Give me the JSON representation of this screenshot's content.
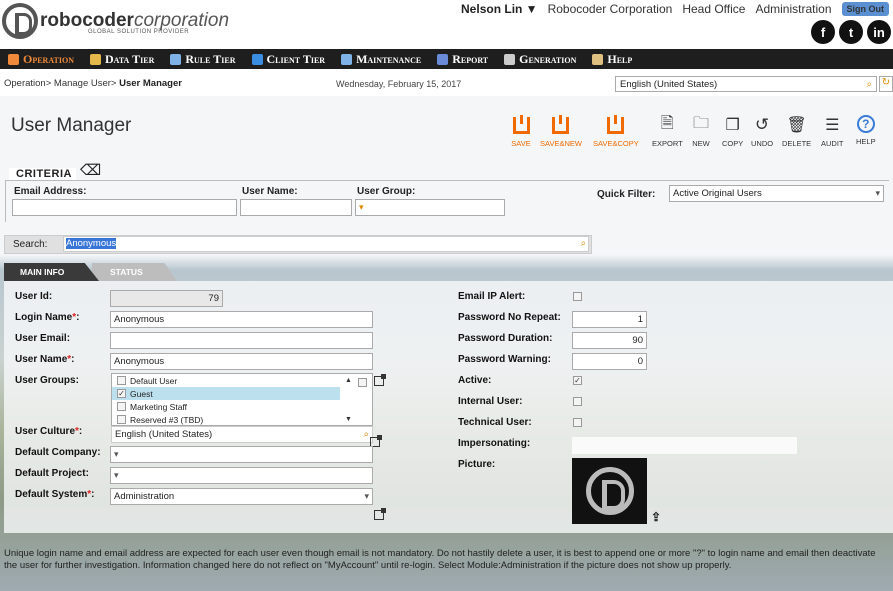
{
  "header": {
    "logo_bold": "robocoder",
    "logo_italic": "corporation",
    "logo_sub": "GLOBAL SOLUTION PROVIDER",
    "user": "Nelson Lin ▼",
    "company": "Robocoder Corporation",
    "office": "Head Office",
    "module": "Administration",
    "signout": "Sign Out",
    "social": [
      "f",
      "t",
      "in"
    ]
  },
  "menu": [
    {
      "label": "Operation",
      "icon": "gear-icon",
      "color": "#f08a3a"
    },
    {
      "label": "Data Tier",
      "icon": "data-icon",
      "color": "#e5b84b"
    },
    {
      "label": "Rule Tier",
      "icon": "rule-icon",
      "color": "#7fb3e8"
    },
    {
      "label": "Client Tier",
      "icon": "client-icon",
      "color": "#3a8de0"
    },
    {
      "label": "Maintenance",
      "icon": "maintenance-icon",
      "color": "#7fb3e8"
    },
    {
      "label": "Report",
      "icon": "report-icon",
      "color": "#6a8bd8"
    },
    {
      "label": "Generation",
      "icon": "generation-icon",
      "color": "#cccccc"
    },
    {
      "label": "Help",
      "icon": "help-book-icon",
      "color": "#e0c080"
    }
  ],
  "breadcrumb": {
    "path": "Operation> Manage User> ",
    "current": "User Manager"
  },
  "date": "Wednesday, February 15, 2017",
  "culture": "English (United States)",
  "page_title": "User Manager",
  "toolbar": [
    {
      "label": "SAVE",
      "name": "save-button",
      "orange": true
    },
    {
      "label": "SAVE&NEW",
      "name": "save-new-button",
      "orange": true
    },
    {
      "label": "SAVE&COPY",
      "name": "save-copy-button",
      "orange": true
    },
    {
      "label": "EXPORT",
      "name": "export-button",
      "orange": false
    },
    {
      "label": "NEW",
      "name": "new-button",
      "orange": false
    },
    {
      "label": "COPY",
      "name": "copy-button",
      "orange": false
    },
    {
      "label": "UNDO",
      "name": "undo-button",
      "orange": false
    },
    {
      "label": "DELETE",
      "name": "delete-button",
      "orange": false
    },
    {
      "label": "AUDIT",
      "name": "audit-button",
      "orange": false
    },
    {
      "label": "HELP",
      "name": "help-button",
      "orange": false
    }
  ],
  "criteria": {
    "title": "CRITERIA",
    "email_label": "Email Address:",
    "username_label": "User Name:",
    "group_label": "User Group:",
    "quick_label": "Quick Filter:",
    "quick_value": "Active Original Users"
  },
  "search": {
    "label": "Search:",
    "value": "Anonymous"
  },
  "tabs": [
    "MAIN INFO",
    "STATUS"
  ],
  "form": {
    "user_id_label": "User Id:",
    "user_id": "79",
    "login_label": "Login Name",
    "login": "Anonymous",
    "email_label": "User Email:",
    "email": "",
    "username_label": "User Name",
    "username": "Anonymous",
    "groups_label": "User Groups:",
    "groups": [
      {
        "label": "Default User",
        "checked": false
      },
      {
        "label": "Guest",
        "checked": true
      },
      {
        "label": "Marketing Staff",
        "checked": false
      },
      {
        "label": "Reserved #3 (TBD)",
        "checked": false
      }
    ],
    "culture_label": "User Culture",
    "culture": "English (United States)",
    "company_label": "Default Company:",
    "project_label": "Default Project:",
    "system_label": "Default System",
    "system": "Administration",
    "ip_label": "Email IP Alert:",
    "norepeat_label": "Password No Repeat:",
    "norepeat": "1",
    "duration_label": "Password Duration:",
    "duration": "90",
    "warning_label": "Password Warning:",
    "warning": "0",
    "active_label": "Active:",
    "internal_label": "Internal User:",
    "technical_label": "Technical User:",
    "impersonating_label": "Impersonating:",
    "picture_label": "Picture:"
  },
  "note": "Unique login name and email address are expected for each user even though email is not mandatory. Do not hastily delete a user, it is best to append one or more \"?\" to login name and email then deactivate the user for further investigation. Information changed here do not reflect on \"MyAccount\" until re-login. Select Module:Administration if the picture does not show up properly."
}
